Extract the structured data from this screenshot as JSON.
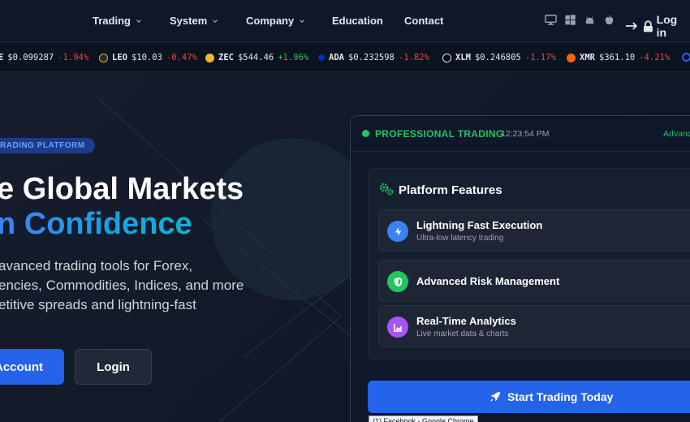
{
  "nav": {
    "items": [
      {
        "label": "Trading",
        "dropdown": true
      },
      {
        "label": "System",
        "dropdown": true
      },
      {
        "label": "Company",
        "dropdown": true
      },
      {
        "label": "Education",
        "dropdown": false
      },
      {
        "label": "Contact",
        "dropdown": false
      }
    ],
    "platforms": [
      "desktop-icon",
      "windows-icon",
      "android-icon",
      "apple-icon"
    ],
    "login_label": "Log in"
  },
  "ticker": [
    {
      "symbol": "E",
      "price": "$0.099287",
      "change": "-1.94%",
      "dir": "neg"
    },
    {
      "symbol": "LEO",
      "price": "$10.03",
      "change": "-0.47%",
      "dir": "neg"
    },
    {
      "symbol": "ZEC",
      "price": "$544.46",
      "change": "+1.96%",
      "dir": "pos"
    },
    {
      "symbol": "ADA",
      "price": "$0.232598",
      "change": "-1.82%",
      "dir": "neg"
    },
    {
      "symbol": "XLM",
      "price": "$0.246805",
      "change": "-1.17%",
      "dir": "neg"
    },
    {
      "symbol": "XMR",
      "price": "$361.10",
      "change": "-4.21%",
      "dir": "neg"
    }
  ],
  "hero": {
    "badge": "RADING PLATFORM",
    "headline_line1": "e Global Markets",
    "headline_line2": "n Confidence",
    "desc_line1": "avanced trading tools for Forex,",
    "desc_line2": "encies, Commodities, Indices, and more",
    "desc_line3": "etitive spreads and lightning-fast",
    "primary_button": "Account",
    "secondary_button": "Login"
  },
  "panel": {
    "title": "PROFESSIONAL TRADING",
    "time": "12:23:54 PM",
    "right_label": "Advanc",
    "features_title": "Platform Features",
    "features": [
      {
        "title": "Lightning Fast Execution",
        "subtitle": "Ultra-low latency trading",
        "icon": "lightning-icon",
        "color": "#3b82f6"
      },
      {
        "title": "Advanced Risk Management",
        "subtitle": "",
        "icon": "shield-icon",
        "color": "#22c55e"
      },
      {
        "title": "Real-Time Analytics",
        "subtitle": "Live market data & charts",
        "icon": "chart-icon",
        "color": "#a855f7"
      }
    ],
    "cta_label": "Start Trading Today"
  },
  "tooltip": "(1) Facebook - Google Chrome",
  "colors": {
    "accent": "#2563eb",
    "positive": "#22c55e",
    "negative": "#ef4444",
    "background": "#111827"
  }
}
